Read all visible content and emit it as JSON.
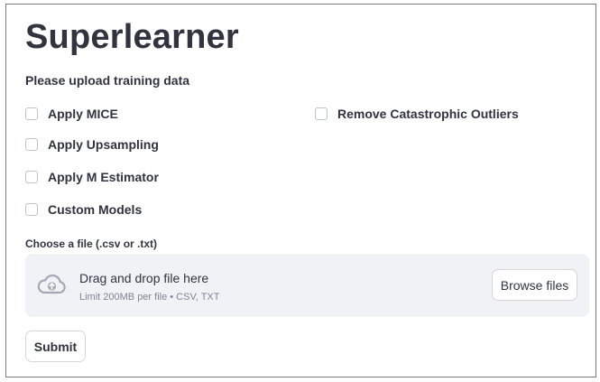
{
  "app": {
    "title": "Superlearner",
    "subtitle": "Please upload training data"
  },
  "options": {
    "apply_mice": {
      "label": "Apply MICE",
      "checked": false
    },
    "apply_upsampling": {
      "label": "Apply Upsampling",
      "checked": false
    },
    "apply_m_estimator": {
      "label": "Apply M Estimator",
      "checked": false
    },
    "custom_models": {
      "label": "Custom Models",
      "checked": false
    },
    "remove_outliers": {
      "label": "Remove Catastrophic Outliers",
      "checked": false
    }
  },
  "uploader": {
    "label": "Choose a file (.csv or .txt)",
    "drop_text": "Drag and drop file here",
    "limit_text": "Limit 200MB per file • CSV, TXT",
    "browse_label": "Browse files",
    "icon": "cloud-upload-icon"
  },
  "actions": {
    "submit_label": "Submit"
  },
  "colors": {
    "text": "#31333f",
    "muted": "#808495",
    "dropzone_bg": "#f0f2f6",
    "border": "#d6d6d9"
  }
}
